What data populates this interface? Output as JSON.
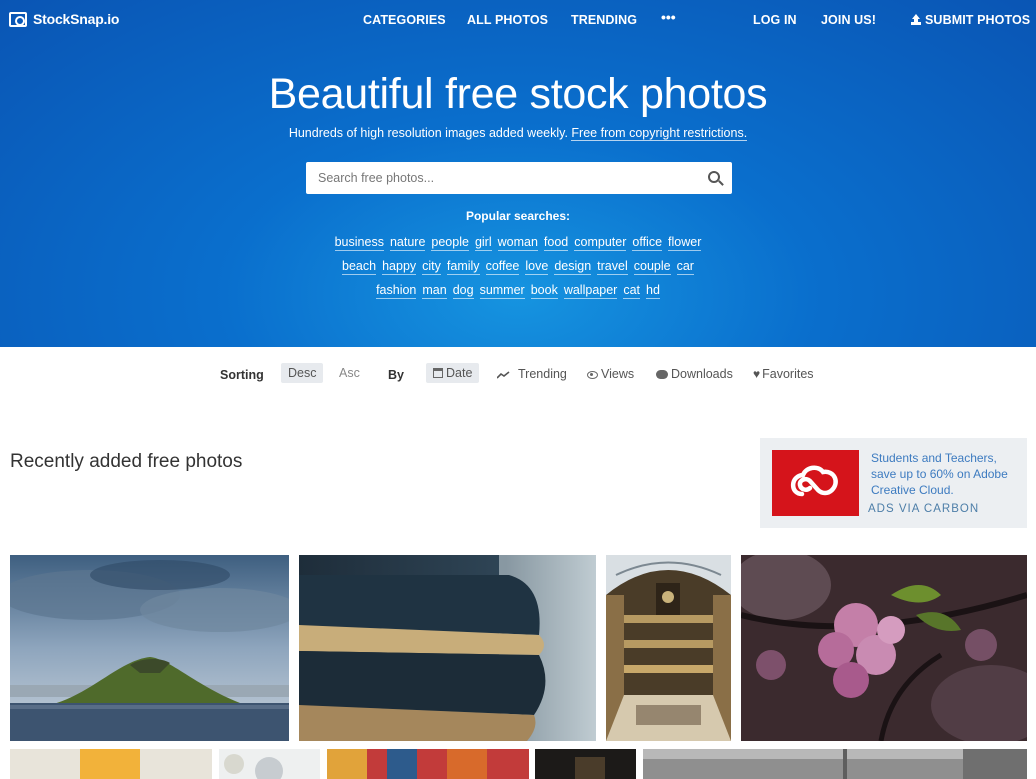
{
  "nav": {
    "logo": "StockSnap.io",
    "links": [
      "CATEGORIES",
      "ALL PHOTOS",
      "TRENDING"
    ],
    "more": "•••",
    "login": "LOG IN",
    "join": "JOIN US!",
    "submit": "SUBMIT PHOTOS"
  },
  "hero": {
    "title": "Beautiful free stock photos",
    "subtitle": "Hundreds of high resolution images added weekly.",
    "subtitle_link": "Free from copyright restrictions.",
    "search_placeholder": "Search free photos...",
    "popular_label": "Popular searches:",
    "tags_row1": [
      "business",
      "nature",
      "people",
      "girl",
      "woman",
      "food",
      "computer",
      "office",
      "flower"
    ],
    "tags_row2": [
      "beach",
      "happy",
      "city",
      "family",
      "coffee",
      "love",
      "design",
      "travel",
      "couple",
      "car"
    ],
    "tags_row3": [
      "fashion",
      "man",
      "dog",
      "summer",
      "book",
      "wallpaper",
      "cat",
      "hd"
    ]
  },
  "sort": {
    "label": "Sorting",
    "desc": "Desc",
    "asc": "Asc",
    "by": "By",
    "date": "Date",
    "trending": "Trending",
    "views": "Views",
    "downloads": "Downloads",
    "favorites": "Favorites"
  },
  "section": {
    "title": "Recently added free photos"
  },
  "ad": {
    "text": "Students and Teachers, save up to 60% on Adobe Creative Cloud.",
    "via": "ADS VIA CARBON"
  }
}
